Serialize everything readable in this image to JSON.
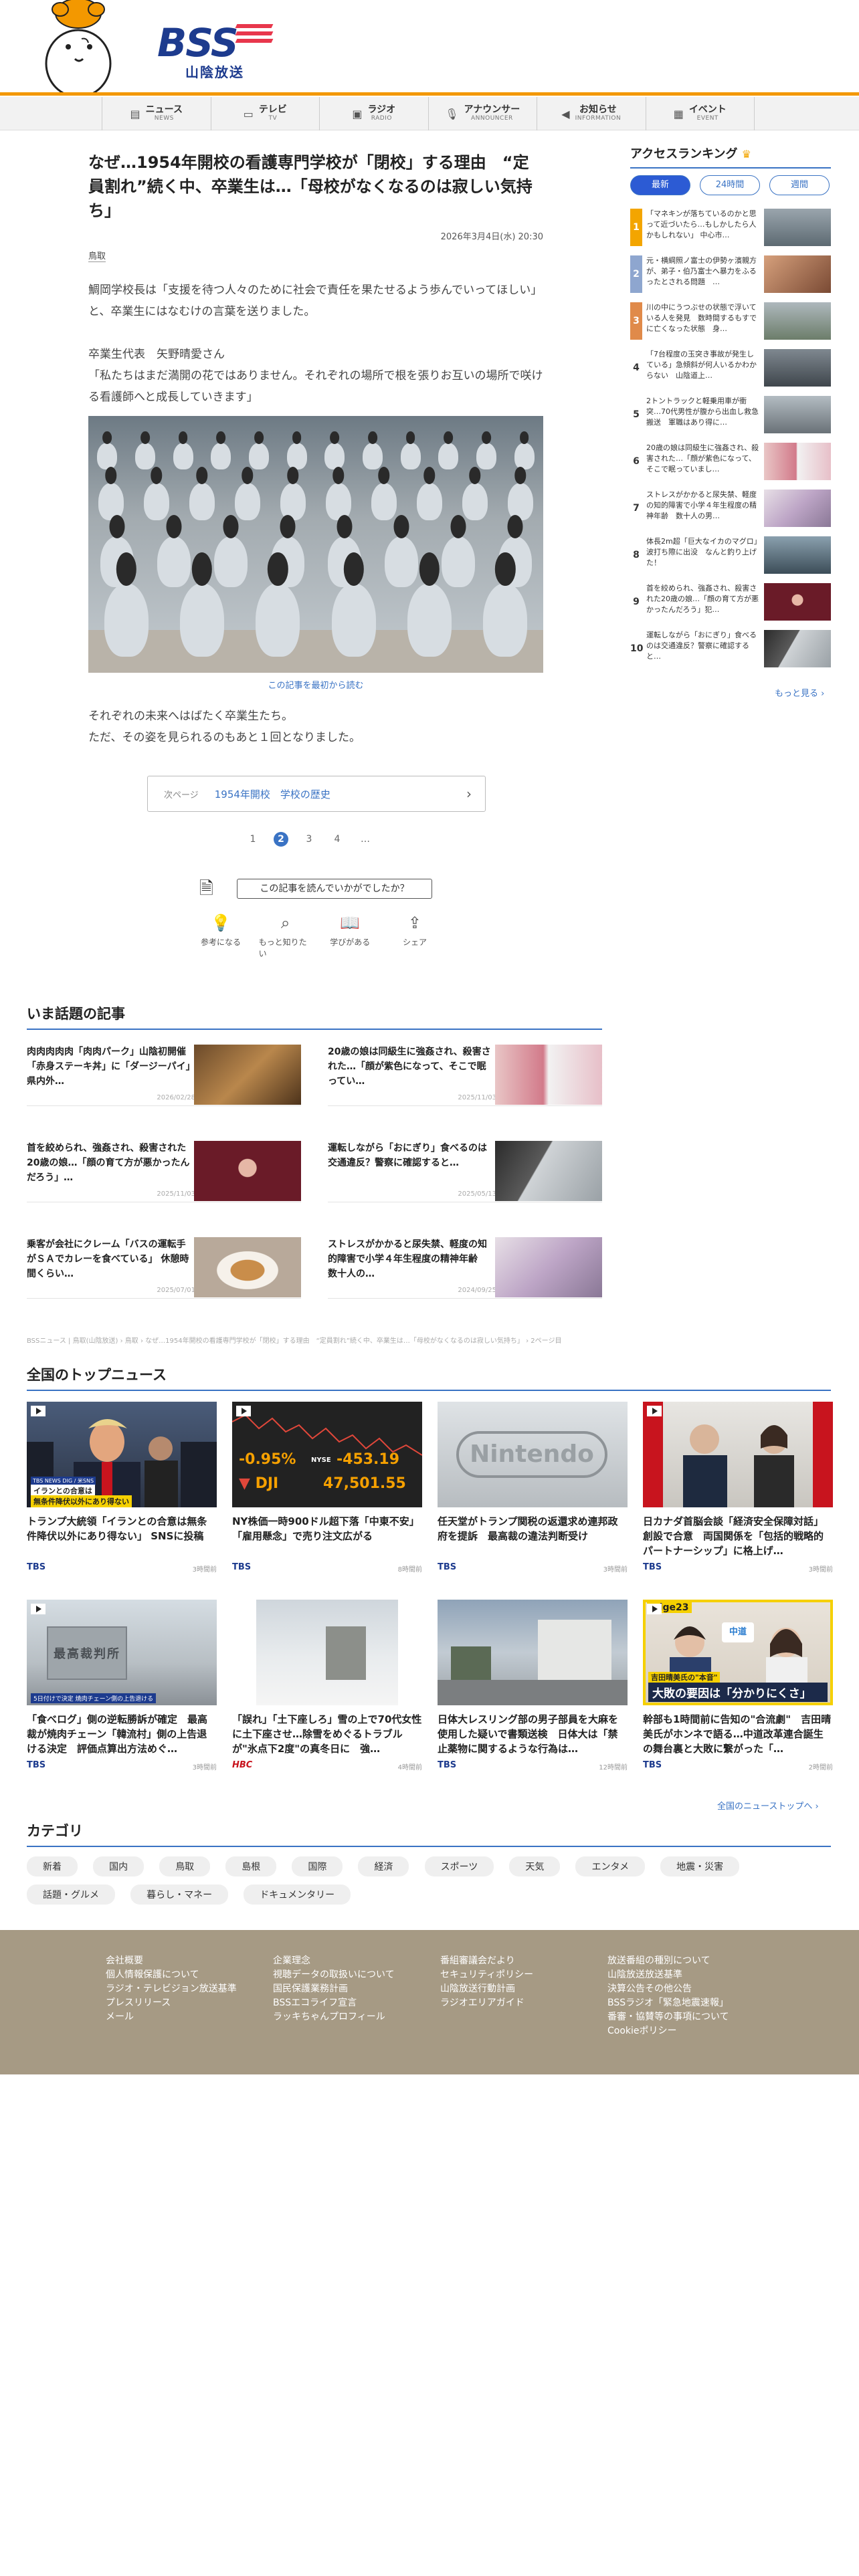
{
  "header": {
    "logo": "BSS",
    "logo_sub": "山陰放送",
    "colors": {
      "orange": "#f39800",
      "navy": "#1d3b8e",
      "red": "#e8374c",
      "blue": "#3a73c4"
    }
  },
  "nav": [
    {
      "icon": "news-icon",
      "jp": "ニュース",
      "en": "NEWS"
    },
    {
      "icon": "tv-icon",
      "jp": "テレビ",
      "en": "TV"
    },
    {
      "icon": "radio-icon",
      "jp": "ラジオ",
      "en": "RADIO"
    },
    {
      "icon": "microphone-icon",
      "jp": "アナウンサー",
      "en": "ANNOUNCER"
    },
    {
      "icon": "megaphone-icon",
      "jp": "お知らせ",
      "en": "INFORMATION"
    },
    {
      "icon": "event-icon",
      "jp": "イベント",
      "en": "EVENT"
    }
  ],
  "article": {
    "title": "なぜ…1954年開校の看護専門学校が「閉校」する理由　“定員割れ”続く中、卒業生は…「母校がなくなるのは寂しい気持ち」",
    "date": "2026年3月4日(水) 20:30",
    "category": "鳥取",
    "p1": "鯛岡学校長は「支援を待つ人々のために社会で責任を果たせるよう歩んでいってほしい」と、卒業生にはなむけの言葉を送りました。",
    "p2_a": "卒業生代表　矢野晴愛さん",
    "p2_b": "「私たちはまだ満開の花ではありません。それぞれの場所で根を張りお互いの場所で咲ける看護師へと成長していきます」",
    "read_from_top": "この記事を最初から読む",
    "p3_a": "それぞれの未来へはばたく卒業生たち。",
    "p3_b": "ただ、その姿を見られるのもあと１回となりました。",
    "next_key": "次ページ",
    "next_title": "1954年開校　学校の歴史",
    "pages": [
      "1",
      "2",
      "3",
      "4",
      "…"
    ],
    "survey": "この記事を読んでいかがでしたか？",
    "reactions": [
      {
        "icon": "lightbulb-icon",
        "label": "参考になる"
      },
      {
        "icon": "magnifier-icon",
        "label": "もっと知りたい"
      },
      {
        "icon": "book-icon",
        "label": "学びがある"
      },
      {
        "icon": "share-icon",
        "label": "シェア"
      }
    ]
  },
  "trending": {
    "title": "いま話題の記事",
    "items": [
      {
        "title": "肉肉肉肉肉「肉肉パーク」山陰初開催「赤身ステーキ丼」に「ダージーパイ」県内外…",
        "date": "2026/02/28"
      },
      {
        "title": "20歳の娘は同級生に強姦され、殺害された…「顔が紫色になって、そこで眠ってい…",
        "date": "2025/11/03"
      },
      {
        "title": "首を絞められ、強姦され、殺害された20歳の娘…「顔の育て方が悪かったんだろう」…",
        "date": "2025/11/03"
      },
      {
        "title": "運転しながら「おにぎり」食べるのは交通違反？警察に確認すると…",
        "date": "2025/05/13"
      },
      {
        "title": "乗客が会社にクレーム「バスの運転手がＳＡでカレーを食べている」 休憩時間くらい…",
        "date": "2025/07/01"
      },
      {
        "title": "ストレスがかかると尿失禁、軽度の知的障害で小学４年生程度の精神年齢　数十人の…",
        "date": "2024/09/25"
      }
    ]
  },
  "breadcrumb": "BSSニュース | 鳥取(山陰放送) › 鳥取 › なぜ…1954年開校の看護専門学校が「閉校」する理由　“定員割れ”続く中、卒業生は…「母校がなくなるのは寂しい気持ち」 › 2ページ目",
  "national": {
    "title": "全国のトップニュース",
    "more": "全国のニューストップへ ›",
    "cards": [
      {
        "title": "トランプ大統領「イランとの合意は無条件降伏以外にあり得ない」 SNSに投稿",
        "source": "TBS",
        "ago": "3時間前",
        "caption_a": "イランとの合意は",
        "caption_b": "無条件降伏以外にあり得ない",
        "caption_tag": "TBS NEWS DIG / 米SNS"
      },
      {
        "title": "NY株価一時900ドル超下落「中東不安」「雇用懸念」で売り注文広がる",
        "source": "TBS",
        "ago": "8時間前",
        "nys_pct": "-0.95%",
        "nys_val": "-453.19",
        "nys_label": "NYSE",
        "dji_label": "DJI",
        "dji_val": "47,501.55"
      },
      {
        "title": "任天堂がトランプ関税の返還求め連邦政府を提訴　最高裁の違法判断受け",
        "source": "TBS",
        "ago": "3時間前",
        "sign": "Nintendo"
      },
      {
        "title": "日カナダ首脳会談「経済安全保障対話」創設で合意　両国関係を「包括的戦略的パートナーシップ」に格上げ…",
        "source": "TBS",
        "ago": "3時間前"
      },
      {
        "title": "「食べログ」側の逆転勝訴が確定　最高裁が焼肉チェーン「韓流村」側の上告退ける決定　評価点算出方法めぐ…",
        "source": "TBS",
        "ago": "3時間前",
        "court_sign": "最高裁判所",
        "court_caption": "5日付けで決定 焼肉チェーン側の上告退ける"
      },
      {
        "title": "「誤れ」「土下座しろ」雪の上で70代女性に土下座させ…除雪をめぐるトラブルが\"氷点下2度\"の真冬日に　強…",
        "source": "HBC",
        "ago": "4時間前"
      },
      {
        "title": "日体大レスリング部の男子部員を大麻を使用した疑いで書類送検　日体大は「禁止薬物に関するような行為は…",
        "source": "TBS",
        "ago": "12時間前"
      },
      {
        "title": "幹部も1時間前に告知の\"合流劇\"　吉田晴美氏がホンネで語る…中道改革連合誕生の舞台裏と大敗に繋がった「…",
        "source": "TBS",
        "ago": "2時間前",
        "tag": "edge23",
        "badge": "中道",
        "caption_a": "吉田晴美氏の\"本音\"",
        "caption_b": "大敗の要因は「分かりにくさ」"
      }
    ]
  },
  "categories": {
    "title": "カテゴリ",
    "items": [
      "新着",
      "国内",
      "鳥取",
      "島根",
      "国際",
      "経済",
      "スポーツ",
      "天気",
      "エンタメ",
      "地震・災害",
      "話題・グルメ",
      "暮らし・マネー",
      "ドキュメンタリー"
    ]
  },
  "ranking": {
    "title": "アクセスランキング",
    "tabs": [
      "最新",
      "24時間",
      "週間"
    ],
    "more": "もっと見る ›",
    "items": [
      {
        "rank": "1",
        "title": "「マネキンが落ちているのかと思って近づいたら…もしかしたら人かもしれない」 中心市…"
      },
      {
        "rank": "2",
        "title": "元・横綱照ノ富士の伊勢ヶ濱親方が、弟子・伯乃富士へ暴力をふるったとされる問題　…"
      },
      {
        "rank": "3",
        "title": "川の中にうつぶせの状態で浮いている人を発見　数時間するもすでに亡くなった状態　身…"
      },
      {
        "rank": "4",
        "title": "「7台程度の玉突き事故が発生している」急傾斜が何人いるかわからない　山陰道上…"
      },
      {
        "rank": "5",
        "title": "2トントラックと軽乗用車が衝突…70代男性が腹から出血し救急搬送　軍職はあり得に…"
      },
      {
        "rank": "6",
        "title": "20歳の娘は同級生に強姦され、殺害された…「顔が紫色になって、そこで眠っていまし…"
      },
      {
        "rank": "7",
        "title": "ストレスがかかると尿失禁、軽度の知的障害で小学４年生程度の精神年齢　数十人の男…"
      },
      {
        "rank": "8",
        "title": "体長2m超「巨大なイカのマグロ」波打ち際に出没　なんと釣り上げた！"
      },
      {
        "rank": "9",
        "title": "首を絞められ、強姦され、殺害された20歳の娘…「顔の育て方が悪かったんだろう」犯…"
      },
      {
        "rank": "10",
        "title": "運転しながら「おにぎり」食べるのは交通違反？警察に確認すると…"
      }
    ],
    "colors": [
      "#f3a500",
      "#8ea6cf",
      "#e08a4a"
    ]
  },
  "footer": {
    "columns": [
      [
        "会社概要",
        "個人情報保護について",
        "ラジオ・テレビジョン放送基準",
        "プレスリリース",
        "メール"
      ],
      [
        "企業理念",
        "視聴データの取扱いについて",
        "国民保護業務計画",
        "BSSエコライフ宣言",
        "ラッキちゃんプロフィール"
      ],
      [
        "番組審議会だより",
        "セキュリティポリシー",
        "山陰放送行動計画",
        "ラジオエリアガイド"
      ],
      [
        "放送番組の種別について",
        "山陰放送放送基準",
        "決算公告その他公告",
        "BSSラジオ「緊急地震速報」",
        "番審・協賛等の事項について",
        "Cookieポリシー"
      ]
    ]
  }
}
